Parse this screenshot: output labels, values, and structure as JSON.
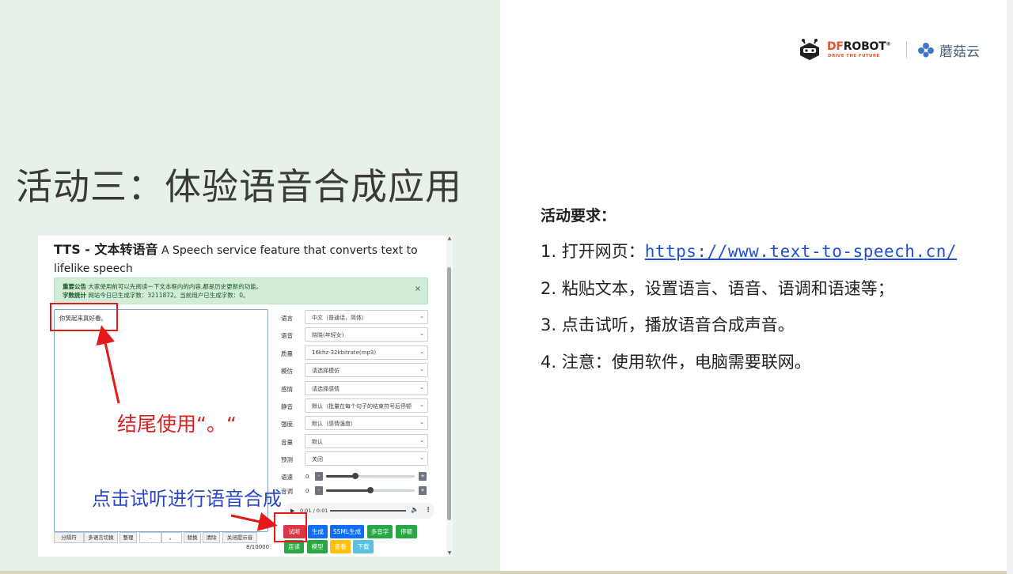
{
  "logo": {
    "brand_d": "DF",
    "brand_rest": "ROBOT",
    "reg_mark": "®",
    "tagline": "DRIVE THE FUTURE",
    "partner_name": "蘑菇云"
  },
  "slide": {
    "title": "活动三：体验语音合成应用",
    "requirements_heading": "活动要求：",
    "requirements": [
      {
        "prefix": "1.  打开网页：",
        "link": "https://www.text-to-speech.cn/"
      },
      {
        "text": "2.  粘贴文本，设置语言、语音、语调和语速等；"
      },
      {
        "text": "3.  点击试听，播放语音合成声音。"
      },
      {
        "text": "4.  注意：使用软件，电脑需要联网。"
      }
    ]
  },
  "annotations": {
    "ending_hint": "结尾使用“。“",
    "preview_hint": "点击试听进行语音合成"
  },
  "tts_page": {
    "title_strong": "TTS - 文本转语音",
    "title_rest": " A Speech service feature that converts text to lifelike speech",
    "notice_label_1": "重要公告",
    "notice_text_1": " 大家使用前可以先阅读一下文本框内的内容,都是历史更新的功能。",
    "notice_label_2": "字数统计",
    "notice_text_2": " 网站今日已生成字数：3211872。当前用户已生成字数：0。",
    "close_symbol": "×",
    "textarea_value": "你笑起来真好看。",
    "fields": [
      {
        "label": "语言",
        "value": "中文（普通话，简体）"
      },
      {
        "label": "语音",
        "value": "晓晓(年轻女)"
      },
      {
        "label": "质量",
        "value": "16khz-32kbitrate(mp3)"
      },
      {
        "label": "模仿",
        "value": "请选择模仿"
      },
      {
        "label": "感情",
        "value": "请选择感情"
      },
      {
        "label": "静音",
        "value": "默认（批量在每个句子的结束符号后停顿"
      },
      {
        "label": "强度",
        "value": "默认（感情强度）"
      },
      {
        "label": "音量",
        "value": "默认"
      },
      {
        "label": "预测",
        "value": "关闭"
      }
    ],
    "speed": {
      "label": "语速",
      "value": "0",
      "level": 0.33
    },
    "pitch": {
      "label": "音调",
      "value": "0",
      "level": 0.5
    },
    "minus_symbol": "-",
    "plus_symbol": "+",
    "audio": {
      "time": "0:01 / 0:01"
    },
    "buttons": {
      "preview": "试听",
      "generate": "生成",
      "ssml": "SSML生成",
      "polyphone": "多音字",
      "pause": "停顿",
      "continuous": "连读",
      "model": "模型",
      "view": "查看",
      "download": "下载"
    },
    "toolbar": {
      "separator": "分隔符",
      "multilang": "多语言切换",
      "tidy": "整理",
      "input_1": ".",
      "input_2": "。",
      "replace": "替换",
      "clear": "清除",
      "close_hint": "关闭提示音"
    },
    "counter": "8/10000"
  },
  "colors": {
    "left_panel": "#e6f2e7",
    "annotation_red": "#d92020",
    "annotation_blue": "#2b47c8",
    "link_blue": "#1f4fd9"
  }
}
